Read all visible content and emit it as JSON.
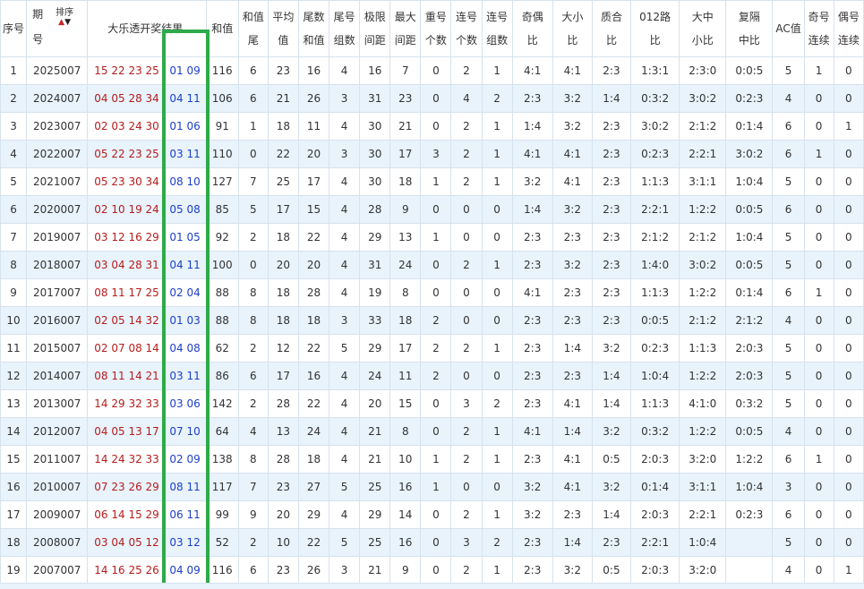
{
  "headers": {
    "seq": "序号",
    "period_line1": "期",
    "period_line2": "号",
    "sort_label": "排序",
    "result": "大乐透开奖结果",
    "sum": "和值",
    "sum_tail_1": "和值",
    "sum_tail_2": "尾",
    "avg_1": "平均",
    "avg_2": "值",
    "tail_sum_1": "尾数",
    "tail_sum_2": "和值",
    "tail_groups_1": "尾号",
    "tail_groups_2": "组数",
    "range_1": "极限",
    "range_2": "间距",
    "max_gap_1": "最大",
    "max_gap_2": "间距",
    "repeat_1": "重号",
    "repeat_2": "个数",
    "consec_1": "连号",
    "consec_2": "个数",
    "consec_groups_1": "连号",
    "consec_groups_2": "组数",
    "odd_even_1": "奇偶",
    "odd_even_2": "比",
    "big_small_1": "大小",
    "big_small_2": "比",
    "prime_comp_1": "质合",
    "prime_comp_2": "比",
    "route012_1": "012路",
    "route012_2": "比",
    "big_mid_small_1": "大中",
    "big_mid_small_2": "小比",
    "repeat_mid_1": "复隔",
    "repeat_mid_2": "中比",
    "ac": "AC值",
    "odd_streak_1": "奇号",
    "odd_streak_2": "连续",
    "even_streak_1": "偶号",
    "even_streak_2": "连续"
  },
  "rows": [
    {
      "seq": "1",
      "period": "2025007",
      "front": "15 22 23 25 3",
      "back": "01 09",
      "sum": "116",
      "sum_tail": "6",
      "avg": "23",
      "tail_sum": "16",
      "tail_groups": "4",
      "range": "16",
      "max_gap": "7",
      "repeat": "0",
      "consec": "2",
      "consec_groups": "1",
      "odd_even": "4:1",
      "big_small": "4:1",
      "prime_comp": "2:3",
      "route012": "1:3:1",
      "big_mid_small": "2:3:0",
      "repeat_mid": "0:0:5",
      "ac": "5",
      "odd_streak": "1",
      "even_streak": "0"
    },
    {
      "seq": "2",
      "period": "2024007",
      "front": "04 05 28 34 3",
      "back": "04 11",
      "sum": "106",
      "sum_tail": "6",
      "avg": "21",
      "tail_sum": "26",
      "tail_groups": "3",
      "range": "31",
      "max_gap": "23",
      "repeat": "0",
      "consec": "4",
      "consec_groups": "2",
      "odd_even": "2:3",
      "big_small": "3:2",
      "prime_comp": "1:4",
      "route012": "0:3:2",
      "big_mid_small": "3:0:2",
      "repeat_mid": "0:2:3",
      "ac": "4",
      "odd_streak": "0",
      "even_streak": "0"
    },
    {
      "seq": "3",
      "period": "2023007",
      "front": "02 03 24 30 3",
      "back": "01 06",
      "sum": "91",
      "sum_tail": "1",
      "avg": "18",
      "tail_sum": "11",
      "tail_groups": "4",
      "range": "30",
      "max_gap": "21",
      "repeat": "0",
      "consec": "2",
      "consec_groups": "1",
      "odd_even": "1:4",
      "big_small": "3:2",
      "prime_comp": "2:3",
      "route012": "3:0:2",
      "big_mid_small": "2:1:2",
      "repeat_mid": "0:1:4",
      "ac": "6",
      "odd_streak": "0",
      "even_streak": "1"
    },
    {
      "seq": "4",
      "period": "2022007",
      "front": "05 22 23 25 3",
      "back": "03 11",
      "sum": "110",
      "sum_tail": "0",
      "avg": "22",
      "tail_sum": "20",
      "tail_groups": "3",
      "range": "30",
      "max_gap": "17",
      "repeat": "3",
      "consec": "2",
      "consec_groups": "1",
      "odd_even": "4:1",
      "big_small": "4:1",
      "prime_comp": "2:3",
      "route012": "0:2:3",
      "big_mid_small": "2:2:1",
      "repeat_mid": "3:0:2",
      "ac": "6",
      "odd_streak": "1",
      "even_streak": "0"
    },
    {
      "seq": "5",
      "period": "2021007",
      "front": "05 23 30 34 3",
      "back": "08 10",
      "sum": "127",
      "sum_tail": "7",
      "avg": "25",
      "tail_sum": "17",
      "tail_groups": "4",
      "range": "30",
      "max_gap": "18",
      "repeat": "1",
      "consec": "2",
      "consec_groups": "1",
      "odd_even": "3:2",
      "big_small": "4:1",
      "prime_comp": "2:3",
      "route012": "1:1:3",
      "big_mid_small": "3:1:1",
      "repeat_mid": "1:0:4",
      "ac": "5",
      "odd_streak": "0",
      "even_streak": "0"
    },
    {
      "seq": "6",
      "period": "2020007",
      "front": "02 10 19 24 3",
      "back": "05 08",
      "sum": "85",
      "sum_tail": "5",
      "avg": "17",
      "tail_sum": "15",
      "tail_groups": "4",
      "range": "28",
      "max_gap": "9",
      "repeat": "0",
      "consec": "0",
      "consec_groups": "0",
      "odd_even": "1:4",
      "big_small": "3:2",
      "prime_comp": "2:3",
      "route012": "2:2:1",
      "big_mid_small": "1:2:2",
      "repeat_mid": "0:0:5",
      "ac": "6",
      "odd_streak": "0",
      "even_streak": "0"
    },
    {
      "seq": "7",
      "period": "2019007",
      "front": "03 12 16 29 3",
      "back": "01 05",
      "sum": "92",
      "sum_tail": "2",
      "avg": "18",
      "tail_sum": "22",
      "tail_groups": "4",
      "range": "29",
      "max_gap": "13",
      "repeat": "1",
      "consec": "0",
      "consec_groups": "0",
      "odd_even": "2:3",
      "big_small": "2:3",
      "prime_comp": "2:3",
      "route012": "2:1:2",
      "big_mid_small": "2:1:2",
      "repeat_mid": "1:0:4",
      "ac": "5",
      "odd_streak": "0",
      "even_streak": "0"
    },
    {
      "seq": "8",
      "period": "2018007",
      "front": "03 04 28 31 3",
      "back": "04 11",
      "sum": "100",
      "sum_tail": "0",
      "avg": "20",
      "tail_sum": "20",
      "tail_groups": "4",
      "range": "31",
      "max_gap": "24",
      "repeat": "0",
      "consec": "2",
      "consec_groups": "1",
      "odd_even": "2:3",
      "big_small": "3:2",
      "prime_comp": "2:3",
      "route012": "1:4:0",
      "big_mid_small": "3:0:2",
      "repeat_mid": "0:0:5",
      "ac": "5",
      "odd_streak": "0",
      "even_streak": "0"
    },
    {
      "seq": "9",
      "period": "2017007",
      "front": "08 11 17 25 2",
      "back": "02 04",
      "sum": "88",
      "sum_tail": "8",
      "avg": "18",
      "tail_sum": "28",
      "tail_groups": "4",
      "range": "19",
      "max_gap": "8",
      "repeat": "0",
      "consec": "0",
      "consec_groups": "0",
      "odd_even": "4:1",
      "big_small": "2:3",
      "prime_comp": "2:3",
      "route012": "1:1:3",
      "big_mid_small": "1:2:2",
      "repeat_mid": "0:1:4",
      "ac": "6",
      "odd_streak": "1",
      "even_streak": "0"
    },
    {
      "seq": "10",
      "period": "2016007",
      "front": "02 05 14 32 3",
      "back": "01 03",
      "sum": "88",
      "sum_tail": "8",
      "avg": "18",
      "tail_sum": "18",
      "tail_groups": "3",
      "range": "33",
      "max_gap": "18",
      "repeat": "2",
      "consec": "0",
      "consec_groups": "0",
      "odd_even": "2:3",
      "big_small": "2:3",
      "prime_comp": "2:3",
      "route012": "0:0:5",
      "big_mid_small": "2:1:2",
      "repeat_mid": "2:1:2",
      "ac": "4",
      "odd_streak": "0",
      "even_streak": "0"
    },
    {
      "seq": "11",
      "period": "2015007",
      "front": "02 07 08 14 3",
      "back": "04 08",
      "sum": "62",
      "sum_tail": "2",
      "avg": "12",
      "tail_sum": "22",
      "tail_groups": "5",
      "range": "29",
      "max_gap": "17",
      "repeat": "2",
      "consec": "2",
      "consec_groups": "1",
      "odd_even": "2:3",
      "big_small": "1:4",
      "prime_comp": "3:2",
      "route012": "0:2:3",
      "big_mid_small": "1:1:3",
      "repeat_mid": "2:0:3",
      "ac": "5",
      "odd_streak": "0",
      "even_streak": "0"
    },
    {
      "seq": "12",
      "period": "2014007",
      "front": "08 11 14 21 3",
      "back": "03 11",
      "sum": "86",
      "sum_tail": "6",
      "avg": "17",
      "tail_sum": "16",
      "tail_groups": "4",
      "range": "24",
      "max_gap": "11",
      "repeat": "2",
      "consec": "0",
      "consec_groups": "0",
      "odd_even": "2:3",
      "big_small": "2:3",
      "prime_comp": "1:4",
      "route012": "1:0:4",
      "big_mid_small": "1:2:2",
      "repeat_mid": "2:0:3",
      "ac": "5",
      "odd_streak": "0",
      "even_streak": "0"
    },
    {
      "seq": "13",
      "period": "2013007",
      "front": "14 29 32 33 3",
      "back": "03 06",
      "sum": "142",
      "sum_tail": "2",
      "avg": "28",
      "tail_sum": "22",
      "tail_groups": "4",
      "range": "20",
      "max_gap": "15",
      "repeat": "0",
      "consec": "3",
      "consec_groups": "2",
      "odd_even": "2:3",
      "big_small": "4:1",
      "prime_comp": "1:4",
      "route012": "1:1:3",
      "big_mid_small": "4:1:0",
      "repeat_mid": "0:3:2",
      "ac": "5",
      "odd_streak": "0",
      "even_streak": "0"
    },
    {
      "seq": "14",
      "period": "2012007",
      "front": "04 05 13 17 2",
      "back": "07 10",
      "sum": "64",
      "sum_tail": "4",
      "avg": "13",
      "tail_sum": "24",
      "tail_groups": "4",
      "range": "21",
      "max_gap": "8",
      "repeat": "0",
      "consec": "2",
      "consec_groups": "1",
      "odd_even": "4:1",
      "big_small": "1:4",
      "prime_comp": "3:2",
      "route012": "0:3:2",
      "big_mid_small": "1:2:2",
      "repeat_mid": "0:0:5",
      "ac": "4",
      "odd_streak": "0",
      "even_streak": "0"
    },
    {
      "seq": "15",
      "period": "2011007",
      "front": "14 24 32 33 3",
      "back": "02 09",
      "sum": "138",
      "sum_tail": "8",
      "avg": "28",
      "tail_sum": "18",
      "tail_groups": "4",
      "range": "21",
      "max_gap": "10",
      "repeat": "1",
      "consec": "2",
      "consec_groups": "1",
      "odd_even": "2:3",
      "big_small": "4:1",
      "prime_comp": "0:5",
      "route012": "2:0:3",
      "big_mid_small": "3:2:0",
      "repeat_mid": "1:2:2",
      "ac": "6",
      "odd_streak": "1",
      "even_streak": "0"
    },
    {
      "seq": "16",
      "period": "2010007",
      "front": "07 23 26 29 3",
      "back": "08 11",
      "sum": "117",
      "sum_tail": "7",
      "avg": "23",
      "tail_sum": "27",
      "tail_groups": "5",
      "range": "25",
      "max_gap": "16",
      "repeat": "1",
      "consec": "0",
      "consec_groups": "0",
      "odd_even": "3:2",
      "big_small": "4:1",
      "prime_comp": "3:2",
      "route012": "0:1:4",
      "big_mid_small": "3:1:1",
      "repeat_mid": "1:0:4",
      "ac": "3",
      "odd_streak": "0",
      "even_streak": "0"
    },
    {
      "seq": "17",
      "period": "2009007",
      "front": "06 14 15 29 3",
      "back": "06 11",
      "sum": "99",
      "sum_tail": "9",
      "avg": "20",
      "tail_sum": "29",
      "tail_groups": "4",
      "range": "29",
      "max_gap": "14",
      "repeat": "0",
      "consec": "2",
      "consec_groups": "1",
      "odd_even": "3:2",
      "big_small": "2:3",
      "prime_comp": "1:4",
      "route012": "2:0:3",
      "big_mid_small": "2:2:1",
      "repeat_mid": "0:2:3",
      "ac": "6",
      "odd_streak": "0",
      "even_streak": "0"
    },
    {
      "seq": "18",
      "period": "2008007",
      "front": "03 04 05 12 2",
      "back": "03 12",
      "sum": "52",
      "sum_tail": "2",
      "avg": "10",
      "tail_sum": "22",
      "tail_groups": "5",
      "range": "25",
      "max_gap": "16",
      "repeat": "0",
      "consec": "3",
      "consec_groups": "2",
      "odd_even": "2:3",
      "big_small": "1:4",
      "prime_comp": "2:3",
      "route012": "2:2:1",
      "big_mid_small": "1:0:4",
      "repeat_mid": "",
      "ac": "5",
      "odd_streak": "0",
      "even_streak": "0"
    },
    {
      "seq": "19",
      "period": "2007007",
      "front": "14 16 25 26 3",
      "back": "04 09",
      "sum": "116",
      "sum_tail": "6",
      "avg": "23",
      "tail_sum": "26",
      "tail_groups": "3",
      "range": "21",
      "max_gap": "9",
      "repeat": "0",
      "consec": "2",
      "consec_groups": "1",
      "odd_even": "2:3",
      "big_small": "3:2",
      "prime_comp": "0:5",
      "route012": "2:0:3",
      "big_mid_small": "3:2:0",
      "repeat_mid": "",
      "ac": "4",
      "odd_streak": "0",
      "even_streak": "1"
    }
  ],
  "colors": {
    "front_numbers": "#b71c1c",
    "back_numbers": "#1d3fc8",
    "highlight_box": "#2eaa4a",
    "stripe": "#e8f3fc",
    "border": "#d6e2ee"
  }
}
